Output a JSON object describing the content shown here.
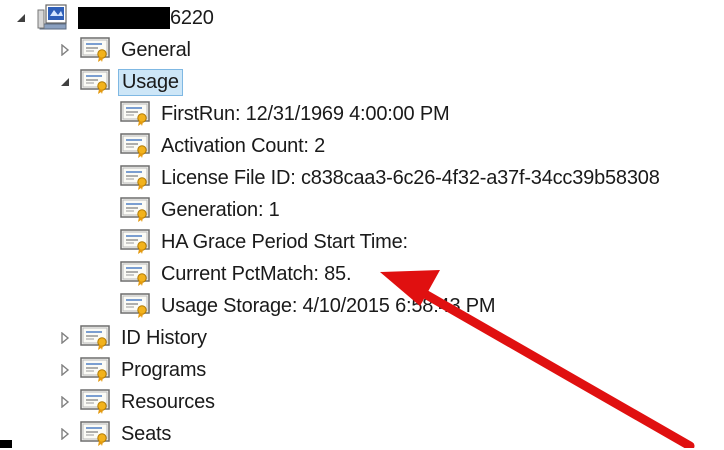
{
  "root": {
    "label_suffix": "6220",
    "expanded": true
  },
  "nodes": [
    {
      "label": "General",
      "expanded": false,
      "level": 1
    },
    {
      "label": "Usage",
      "expanded": true,
      "level": 1,
      "selected": true
    },
    {
      "label": "FirstRun: 12/31/1969 4:00:00 PM",
      "level": 2
    },
    {
      "label": "Activation Count: 2",
      "level": 2
    },
    {
      "label": "License File ID: c838caa3-6c26-4f32-a37f-34cc39b58308",
      "level": 2
    },
    {
      "label": "Generation: 1",
      "level": 2
    },
    {
      "label": "HA Grace Period Start Time:",
      "level": 2
    },
    {
      "label": "Current PctMatch: 85.",
      "level": 2
    },
    {
      "label": "Usage Storage: 4/10/2015 6:58:43 PM",
      "level": 2
    },
    {
      "label": "ID History",
      "expanded": false,
      "level": 1
    },
    {
      "label": "Programs",
      "expanded": false,
      "level": 1
    },
    {
      "label": "Resources",
      "expanded": false,
      "level": 1
    },
    {
      "label": "Seats",
      "expanded": false,
      "level": 1
    }
  ],
  "icons": {
    "root": "license-server-icon",
    "node": "certificate-icon",
    "annotation": "red-arrow-annotation"
  },
  "colors": {
    "selection_bg": "#cde6f7",
    "selection_border": "#7fb8e3",
    "arrow": "#e01010"
  }
}
